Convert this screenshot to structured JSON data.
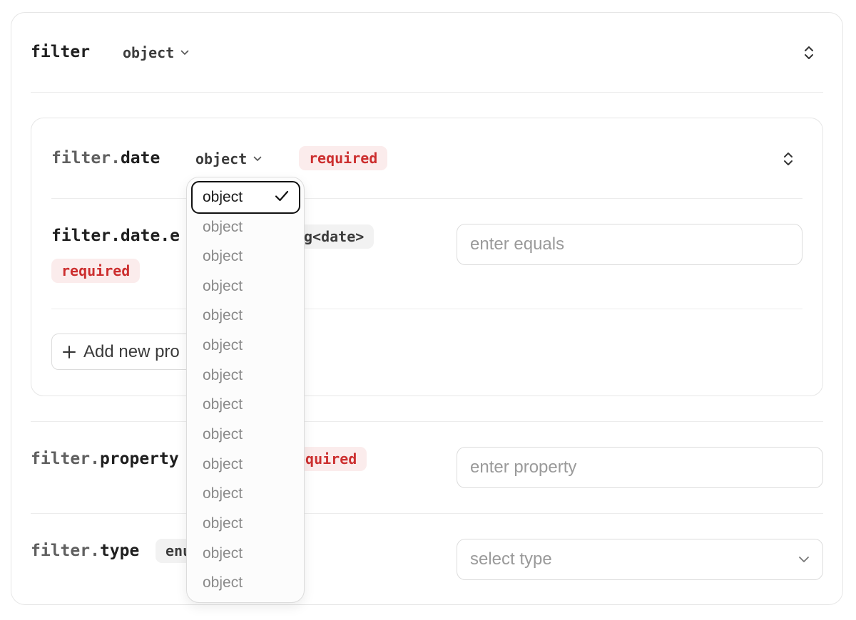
{
  "filter": {
    "name": "filter",
    "type_label": "object"
  },
  "date": {
    "prefix": "filter.",
    "name": "date",
    "type_label": "object",
    "required_label": "required"
  },
  "equals": {
    "name_visible": "filter.date.e",
    "type_visible": "g<date>",
    "required_label": "required",
    "placeholder": "enter equals"
  },
  "add_property": {
    "label_visible": "Add new pro"
  },
  "property": {
    "prefix": "filter.",
    "name": "property",
    "required_visible": "equired",
    "placeholder": "enter property"
  },
  "type_field": {
    "prefix": "filter.",
    "name": "type",
    "type_visible": "enu",
    "placeholder": "select type"
  },
  "dropdown": {
    "selected": "object",
    "options": [
      "object",
      "object",
      "object",
      "object",
      "object",
      "object",
      "object",
      "object",
      "object",
      "object",
      "object",
      "object",
      "object"
    ]
  },
  "colors": {
    "required_text": "#cc2f2f",
    "required_bg": "#fbecec",
    "border": "#e6e6e6"
  },
  "icons": [
    "chevron-down-icon",
    "chevron-up-down-icon",
    "plus-icon",
    "check-icon"
  ]
}
